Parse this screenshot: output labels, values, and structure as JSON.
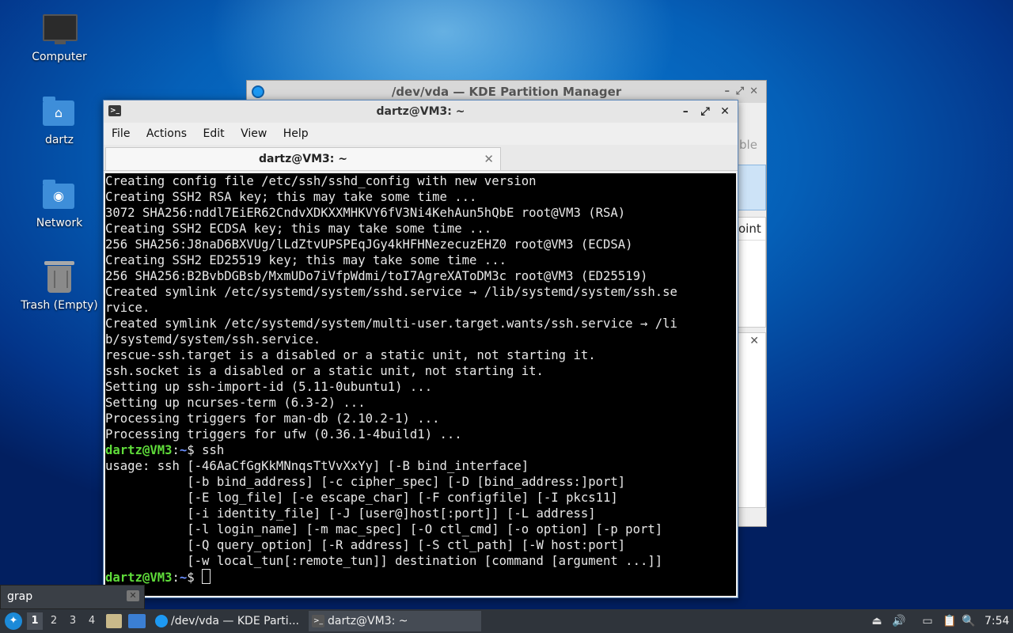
{
  "desktop": {
    "icons": [
      {
        "label": "Computer"
      },
      {
        "label": "dartz"
      },
      {
        "label": "Network"
      },
      {
        "label": "Trash (Empty)"
      }
    ]
  },
  "kde_window": {
    "title": "/dev/vda — KDE Partition Manager",
    "partial_texts": [
      "ble",
      "oint"
    ]
  },
  "terminal_window": {
    "title": "dartz@VM3: ~",
    "menu": [
      "File",
      "Actions",
      "Edit",
      "View",
      "Help"
    ],
    "tab_label": "dartz@VM3: ~",
    "lines": [
      "Creating config file /etc/ssh/sshd_config with new version",
      "Creating SSH2 RSA key; this may take some time ...",
      "3072 SHA256:nddl7EiER62CndvXDKXXMHKVY6fV3Ni4KehAun5hQbE root@VM3 (RSA)",
      "Creating SSH2 ECDSA key; this may take some time ...",
      "256 SHA256:J8naD6BXVUg/lLdZtvUPSPEqJGy4kHFHNezecuzEHZ0 root@VM3 (ECDSA)",
      "Creating SSH2 ED25519 key; this may take some time ...",
      "256 SHA256:B2BvbDGBsb/MxmUDo7iVfpWdmi/toI7AgreXAToDM3c root@VM3 (ED25519)",
      "Created symlink /etc/systemd/system/sshd.service → /lib/systemd/system/ssh.se",
      "rvice.",
      "Created symlink /etc/systemd/system/multi-user.target.wants/ssh.service → /li",
      "b/systemd/system/ssh.service.",
      "rescue-ssh.target is a disabled or a static unit, not starting it.",
      "ssh.socket is a disabled or a static unit, not starting it.",
      "Setting up ssh-import-id (5.11-0ubuntu1) ...",
      "Setting up ncurses-term (6.3-2) ...",
      "Processing triggers for man-db (2.10.2-1) ...",
      "Processing triggers for ufw (0.36.1-4build1) ..."
    ],
    "prompt_user": "dartz@VM3",
    "prompt_sep": ":",
    "prompt_path": "~",
    "prompt_dollar": "$ ",
    "command": "ssh",
    "usage_lines": [
      "usage: ssh [-46AaCfGgKkMNnqsTtVvXxYy] [-B bind_interface]",
      "           [-b bind_address] [-c cipher_spec] [-D [bind_address:]port]",
      "           [-E log_file] [-e escape_char] [-F configfile] [-I pkcs11]",
      "           [-i identity_file] [-J [user@]host[:port]] [-L address]",
      "           [-l login_name] [-m mac_spec] [-O ctl_cmd] [-o option] [-p port]",
      "           [-Q query_option] [-R address] [-S ctl_path] [-W host:port]",
      "           [-w local_tun[:remote_tun]] destination [command [argument ...]]"
    ]
  },
  "search": {
    "value": "grap"
  },
  "taskbar": {
    "workspaces": [
      "1",
      "2",
      "3",
      "4"
    ],
    "tasks": [
      {
        "label": "/dev/vda — KDE Parti..."
      },
      {
        "label": "dartz@VM3: ~"
      }
    ],
    "clock": "7:54"
  }
}
